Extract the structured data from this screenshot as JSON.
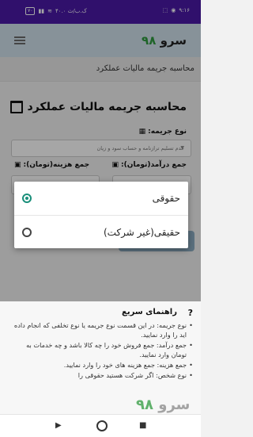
{
  "status": {
    "time": "۹:۱۶",
    "net": "۴۰.۰ ک.ب/ث",
    "battery": "۷۰"
  },
  "app": {
    "brand_word": "سرو",
    "brand_num": "۹۸"
  },
  "breadcrumb": "محاسبه جریمه مالیات عملکرد",
  "page": {
    "title": "محاسبه جریمه مالیات عملکرد",
    "type_label": "نوع جریمه:",
    "type_value": "عدم تسلیم ترازنامه و حساب سود و زیان",
    "income_label": "جمع درآمد(تومان):",
    "expense_label": "جمع هزینه(تومان):"
  },
  "dialog": {
    "options": [
      {
        "label": "حقوقی",
        "selected": true
      },
      {
        "label": "حقیقی(غیر شرکت)",
        "selected": false
      }
    ]
  },
  "guide": {
    "title": "راهنمای سریع",
    "items": [
      "نوع جریمه: در این قسمت نوع جریمه یا نوع تخلفی که انجام داده اید را وارد نمایید.",
      "جمع درآمد: جمع فروش خود را چه کالا باشد و چه خدمات به تومان وارد نمایید.",
      "جمع هزینه: جمع هزینه های خود را وارد نمایید.",
      "نوع شخص: اگر شرکت هستید حقوقی را"
    ]
  },
  "colors": {
    "statusbar": "#4a1aa7",
    "appbar": "#cfe0ec",
    "accent": "#1a8f7a",
    "brand_green": "#2f9a3e"
  }
}
